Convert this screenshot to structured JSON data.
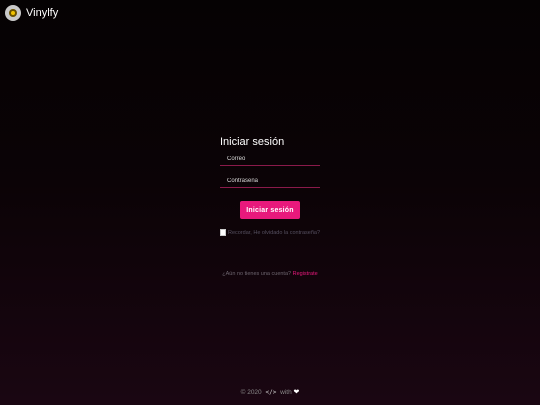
{
  "header": {
    "brand_name": "Vinylfy",
    "logo_icon": "vinyl-record-icon"
  },
  "login": {
    "title": "Iniciar sesión",
    "email_placeholder": "Correo",
    "email_value": "",
    "password_placeholder": "Contraseña",
    "password_value": "",
    "submit_label": "Iniciar sesión",
    "forgot_label": "Recordar, He olvidado la contraseña?",
    "signup_prompt": "¿Aún no tienes una cuenta?",
    "signup_link": "Registrate"
  },
  "footer": {
    "copyright": "© 2020",
    "code_glyph": "</>",
    "with_label": "with",
    "heart_glyph": "❤"
  },
  "colors": {
    "accent": "#e8197c",
    "background_top": "#050203",
    "background_bottom": "#1a0612"
  }
}
